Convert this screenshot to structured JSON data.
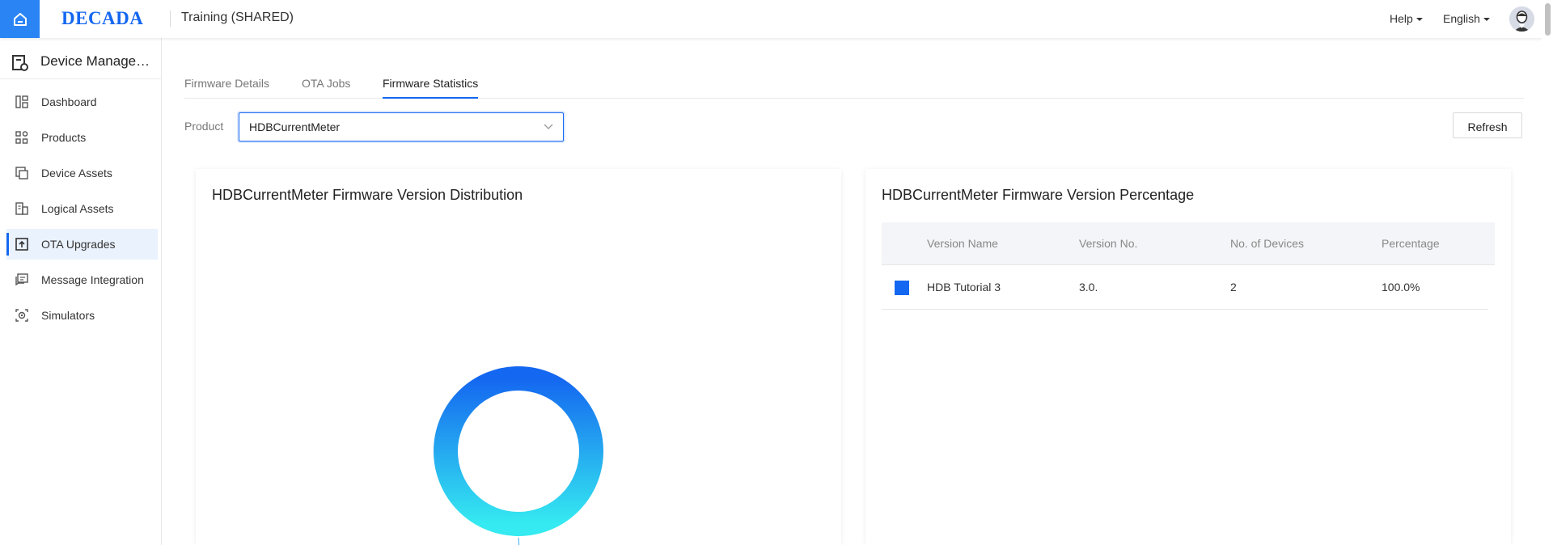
{
  "topbar": {
    "logo": "DECADA",
    "workspace": "Training (SHARED)",
    "help_label": "Help",
    "language_label": "English"
  },
  "sidebar": {
    "header": "Device Management",
    "items": [
      {
        "label": "Dashboard",
        "icon": "dashboard-icon"
      },
      {
        "label": "Products",
        "icon": "products-icon"
      },
      {
        "label": "Device Assets",
        "icon": "device-assets-icon"
      },
      {
        "label": "Logical Assets",
        "icon": "logical-assets-icon"
      },
      {
        "label": "OTA Upgrades",
        "icon": "ota-upgrades-icon",
        "active": true
      },
      {
        "label": "Message Integration",
        "icon": "message-integration-icon"
      },
      {
        "label": "Simulators",
        "icon": "simulators-icon"
      }
    ]
  },
  "tabs": [
    {
      "label": "Firmware Details"
    },
    {
      "label": "OTA Jobs"
    },
    {
      "label": "Firmware Statistics",
      "active": true
    }
  ],
  "filter": {
    "product_label": "Product",
    "product_value": "HDBCurrentMeter",
    "refresh_label": "Refresh"
  },
  "distribution_card": {
    "title": "HDBCurrentMeter Firmware Version Distribution"
  },
  "percentage_card": {
    "title": "HDBCurrentMeter Firmware Version Percentage",
    "columns": [
      "Version Name",
      "Version No.",
      "No. of Devices",
      "Percentage"
    ],
    "rows": [
      {
        "name": "HDB Tutorial 3",
        "version": "3.0.",
        "devices": "2",
        "percentage": "100.0%",
        "color": "#1467f0"
      }
    ]
  },
  "chart_data": {
    "type": "pie",
    "categories": [
      "3.0."
    ],
    "values": [
      2
    ],
    "title": "HDBCurrentMeter Firmware Version Distribution",
    "colors": [
      "#1467f0",
      "#35eaf0"
    ]
  },
  "colors": {
    "accent": "#1467f0",
    "home_button": "#2b84f4"
  }
}
